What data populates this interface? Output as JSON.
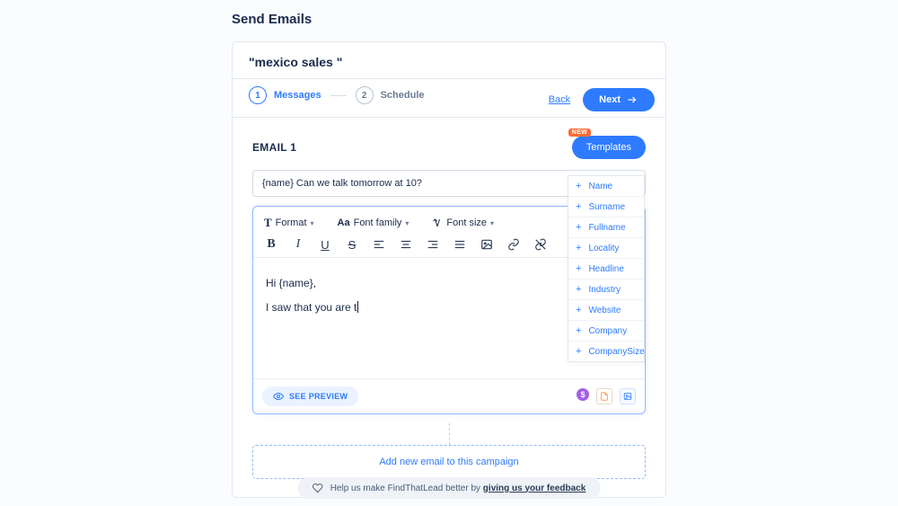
{
  "page": {
    "title": "Send Emails"
  },
  "campaign": {
    "name_quoted": "\"mexico sales \""
  },
  "steps": {
    "items": [
      {
        "num": "1",
        "label": "Messages",
        "active": true
      },
      {
        "num": "2",
        "label": "Schedule",
        "active": false
      }
    ],
    "back_label": "Back",
    "next_label": "Next"
  },
  "email": {
    "title": "EMAIL 1",
    "templates_label": "Templates",
    "templates_badge": "NEW",
    "subject": "{name} Can we talk tomorrow at 10?"
  },
  "toolbar": {
    "format_label": "Format",
    "font_family_label": "Font family",
    "font_size_label": "Font size"
  },
  "body": {
    "line1": "Hi {name},",
    "line2": "I saw that you are t"
  },
  "preview": {
    "label": "SEE PREVIEW"
  },
  "add_email": {
    "label": "Add new email to this campaign"
  },
  "variables": [
    "Name",
    "Surname",
    "Fullname",
    "Locality",
    "Headline",
    "Industry",
    "Website",
    "Company",
    "CompanySize"
  ],
  "feedback": {
    "prefix": "Help us make FindThatLead better by ",
    "link": "giving us your feedback"
  }
}
